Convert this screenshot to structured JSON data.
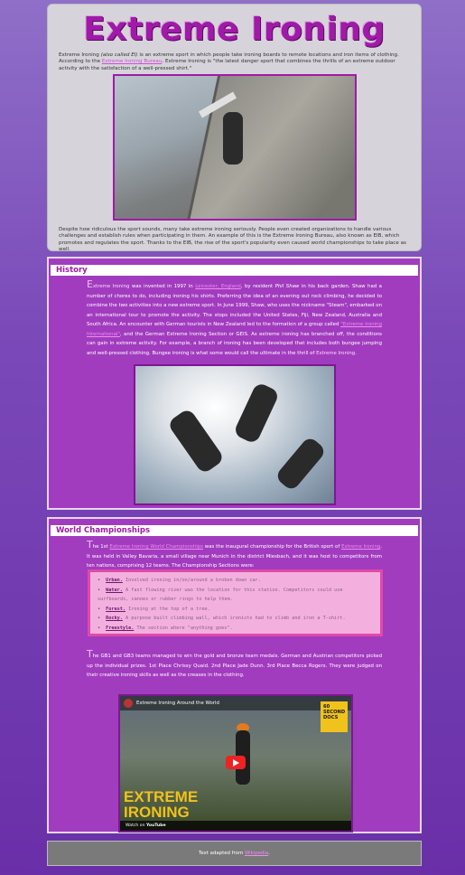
{
  "site": {
    "title": "Extreme Ironing"
  },
  "intro": {
    "p1": {
      "term": "Extreme Ironing",
      "aka": "(also called EI)",
      "text1": "is an extreme sport in which people take ironing boards to remote locations and iron items of clothing. According to the",
      "link": "Extreme Ironing Bureau",
      "term2": "Extreme Ironing",
      "text2": "is \"the latest danger sport that combines the thrills of an extreme outdoor activity with the satisfaction of a well-pressed shirt.\""
    },
    "p2": "Despite how ridiculous the sport sounds, many take extreme ironing seriously. People even created organizations to handle various challenges and establish rules when participating in them. An example of this is the Extreme Ironing Bureau, also known as EIB, which promotes and regulates the sport. Thanks to the EIB, the rise of the sport's popularity even caused world championships to take place as well."
  },
  "history": {
    "heading": "History",
    "dropcap": "E",
    "p1a": "xtreme Ironing",
    "p1b": "was invented in 1997 in",
    "loc": "Leicester, England",
    "p1c": ", by resident",
    "person": "Phil Shaw",
    "p1d": "in his back garden. Shaw had a number of chores to do, including ironing his shirts. Preferring the idea of an evening out rock climbing, he decided to combine the two activities into a new extreme sport. In June 1999, Shaw, who uses the nickname \"Steam\", embarked on an international tour to promote the activity. The stops included the United States, Fiji, New Zealand, Australia and South Africa. An encounter with German tourists in New Zealand led to the formation of a group called",
    "org": "\"Extreme Ironing International\"",
    "p1e": ", and the German Extreme Ironing Section or GEIS. As extreme ironing has branched off, the conditions can gain in extreme activity. For example, a branch of ironing has been developed that includes both bungee jumping and well-pressed clothing. Bungee ironing is what some would call the ultimate in the thrill of",
    "term_end": "Extreme Ironing",
    "p1f": "."
  },
  "worlds": {
    "heading": "World Championships",
    "dropcap": "T",
    "p1a": "he 1st",
    "champ": "Extreme Ironing World Championships",
    "p1b": "was the inaugural championship for the British sport of",
    "term": "Extreme Ironing",
    "p1c": ". It was held in Valley Bavaria, a small village near Munich in the district Miesbach, and it was host to competitors from ten nations, comprising 12 teams. The Championship Sections were:",
    "sections": [
      {
        "term": "Urban.",
        "desc": "Involved ironing in/on/around a broken down car."
      },
      {
        "term": "Water.",
        "desc": "A fast flowing river was the location for this station. Competitors could use surfboards, canoes or rubber rings to help them."
      },
      {
        "term": "Forest.",
        "desc": "Ironing at the top of a tree."
      },
      {
        "term": "Rocky.",
        "desc": "A purpose built climbing wall, which ironists had to climb and iron a T-shirt."
      },
      {
        "term": "Freestyle.",
        "desc": "The section where \"anything goes\"."
      }
    ],
    "dropcap2": "T",
    "p2": "he GB1 and GB3 teams managed to win the gold and bronze team medals. German and Austrian competitors picked up the individual prizes. 1st Place Chrissy Quaid. 2nd Place Jade Dunn. 3rd Place Becca Rogers. They were judged on their creative ironing skills as well as the creases in the clothing."
  },
  "video": {
    "title": "Extreme Ironing Around the World",
    "badge_lines": [
      "60",
      "SECOND",
      "DOCS"
    ],
    "big_text_1": "EXTREME",
    "big_text_2": "IRONING",
    "watch_on": "Watch on",
    "platform": "YouTube"
  },
  "footer": {
    "text": "Text adapted from",
    "link": "Wikipedia",
    "end": "."
  }
}
